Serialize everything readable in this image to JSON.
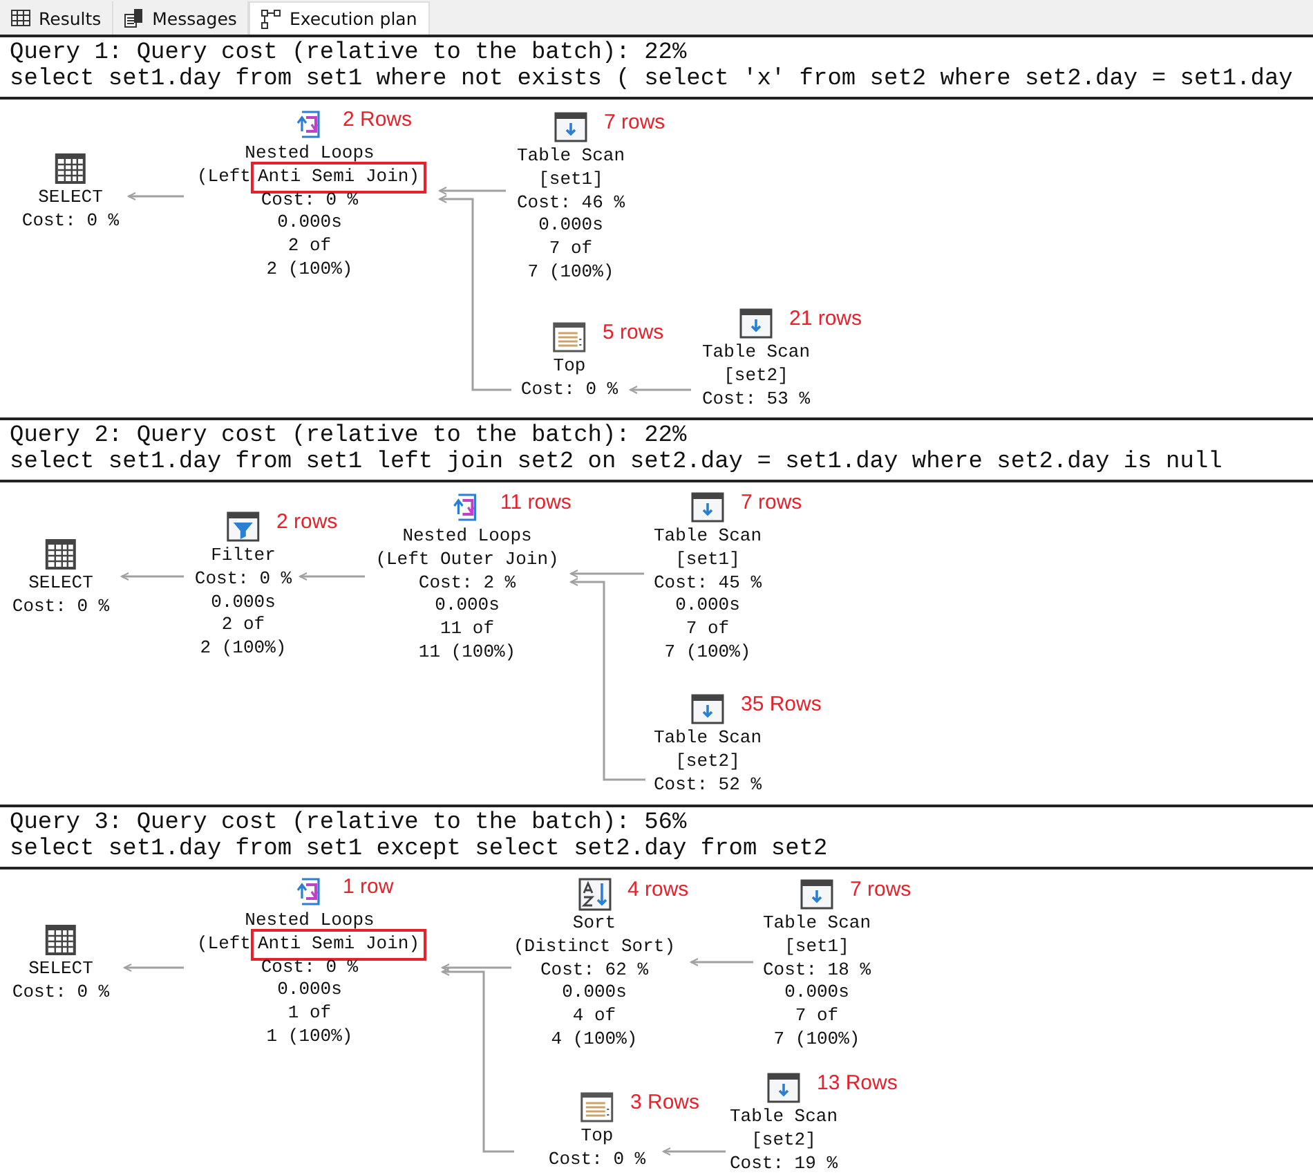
{
  "tabs": [
    {
      "label": "Results",
      "selected": false
    },
    {
      "label": "Messages",
      "selected": false
    },
    {
      "label": "Execution plan",
      "selected": true
    }
  ],
  "queries": [
    {
      "title": "Query 1: Query cost (relative to the batch): 22%",
      "sql": "select set1.day from set1 where not exists ( select 'x' from set2 where set2.day = set1.day",
      "nodes": [
        {
          "kind": "select",
          "lines": [
            "SELECT",
            "Cost: 0 %"
          ]
        },
        {
          "kind": "nested_loops",
          "rows": "2 Rows",
          "lines": [
            "Nested Loops",
            {
              "text": "(Left",
              "boxed": "Anti Semi Join)"
            },
            "Cost: 0 %",
            "0.000s",
            "2 of",
            "2 (100%)"
          ]
        },
        {
          "kind": "table_scan",
          "rows": "7 rows",
          "lines": [
            "Table Scan",
            "[set1]",
            "Cost: 46 %",
            "0.000s",
            "7 of",
            "7 (100%)"
          ]
        },
        {
          "kind": "top",
          "rows": "5 rows",
          "lines": [
            "Top",
            "Cost: 0 %"
          ]
        },
        {
          "kind": "table_scan",
          "rows": "21 rows",
          "lines": [
            "Table Scan",
            "[set2]",
            "Cost: 53 %"
          ]
        }
      ]
    },
    {
      "title": "Query 2: Query cost (relative to the batch): 22%",
      "sql": "select set1.day from set1 left join set2 on set2.day = set1.day where set2.day is null",
      "nodes": [
        {
          "kind": "select",
          "lines": [
            "SELECT",
            "Cost: 0 %"
          ]
        },
        {
          "kind": "filter",
          "rows": "2 rows",
          "lines": [
            "Filter",
            "Cost: 0 %",
            "0.000s",
            "2 of",
            "2 (100%)"
          ]
        },
        {
          "kind": "nested_loops",
          "rows": "11 rows",
          "lines": [
            "Nested Loops",
            "(Left Outer Join)",
            "Cost: 2 %",
            "0.000s",
            "11 of",
            "11 (100%)"
          ]
        },
        {
          "kind": "table_scan",
          "rows": "7 rows",
          "lines": [
            "Table Scan",
            "[set1]",
            "Cost: 45 %",
            "0.000s",
            "7 of",
            "7 (100%)"
          ]
        },
        {
          "kind": "table_scan",
          "rows": "35 Rows",
          "lines": [
            "Table Scan",
            "[set2]",
            "Cost: 52 %"
          ]
        }
      ]
    },
    {
      "title": "Query 3: Query cost (relative to the batch): 56%",
      "sql": "select set1.day from set1 except select set2.day from set2",
      "nodes": [
        {
          "kind": "select",
          "lines": [
            "SELECT",
            "Cost: 0 %"
          ]
        },
        {
          "kind": "nested_loops",
          "rows": "1 row",
          "lines": [
            "Nested Loops",
            {
              "text": "(Left",
              "boxed": "Anti Semi Join)"
            },
            "Cost: 0 %",
            "0.000s",
            "1 of",
            "1 (100%)"
          ]
        },
        {
          "kind": "sort",
          "rows": "4 rows",
          "lines": [
            "Sort",
            "(Distinct Sort)",
            "Cost: 62 %",
            "0.000s",
            "4 of",
            "4 (100%)"
          ]
        },
        {
          "kind": "table_scan",
          "rows": "7 rows",
          "lines": [
            "Table Scan",
            "[set1]",
            "Cost: 18 %",
            "0.000s",
            "7 of",
            "7 (100%)"
          ]
        },
        {
          "kind": "top",
          "rows": "3 Rows",
          "lines": [
            "Top",
            "Cost: 0 %"
          ]
        },
        {
          "kind": "table_scan",
          "rows": "13 Rows",
          "lines": [
            "Table Scan",
            "[set2]",
            "Cost: 19 %"
          ]
        }
      ]
    }
  ]
}
